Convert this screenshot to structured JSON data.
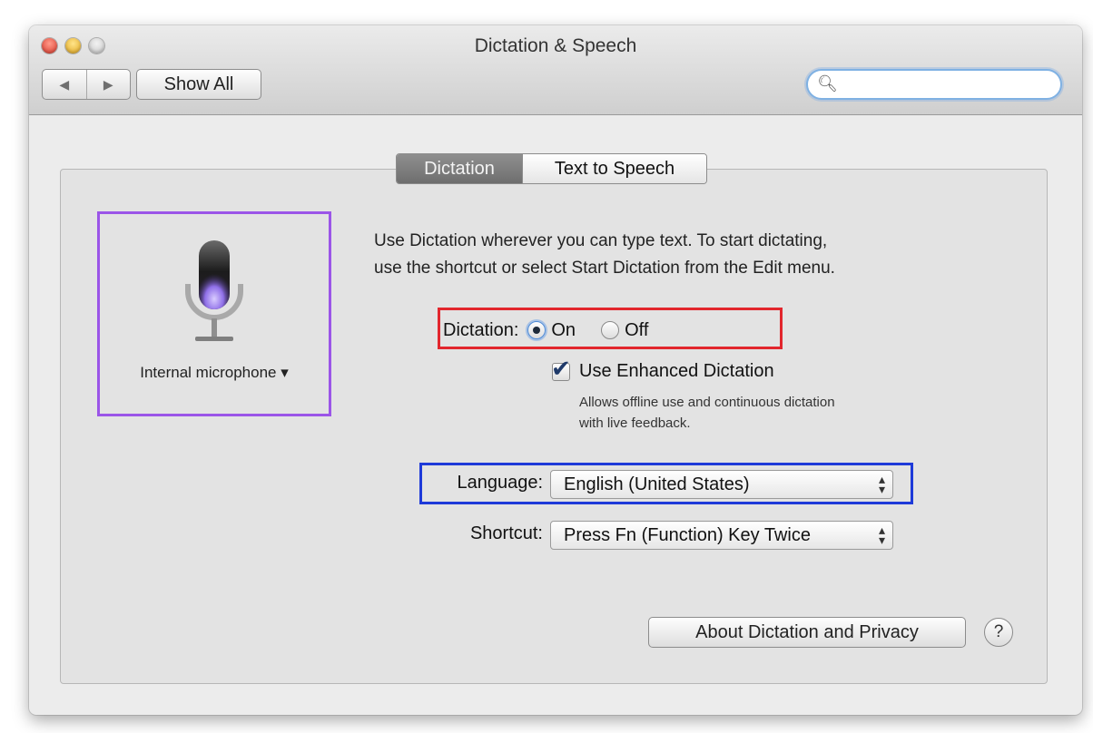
{
  "window": {
    "title": "Dictation & Speech"
  },
  "toolbar": {
    "back_icon": "◀",
    "forward_icon": "▶",
    "show_all_label": "Show All",
    "search": {
      "placeholder": "",
      "value": ""
    }
  },
  "tabs": [
    {
      "label": "Dictation",
      "selected": true
    },
    {
      "label": "Text to Speech",
      "selected": false
    }
  ],
  "microphone": {
    "source_label": "Internal microphone ▾"
  },
  "description": {
    "line1": "Use Dictation wherever you can type text. To start dictating,",
    "line2": "use the shortcut or select Start Dictation from the Edit menu."
  },
  "dictation": {
    "label": "Dictation:",
    "on_label": "On",
    "off_label": "Off",
    "selected": "On"
  },
  "enhanced": {
    "label": "Use Enhanced Dictation",
    "checked": true,
    "help_line1": "Allows offline use and continuous dictation",
    "help_line2": "with live feedback."
  },
  "language": {
    "label": "Language:",
    "value": "English (United States)"
  },
  "shortcut": {
    "label": "Shortcut:",
    "value": "Press Fn (Function) Key Twice"
  },
  "footer": {
    "about_label": "About Dictation and Privacy",
    "help_label": "?"
  },
  "colors": {
    "highlight_purple": "#9b55e8",
    "highlight_red": "#e2262d",
    "highlight_blue": "#1e3ad9",
    "mic_glow": "#8f6fe8"
  }
}
